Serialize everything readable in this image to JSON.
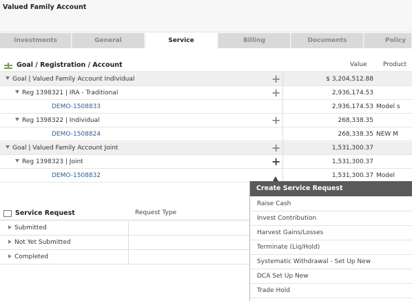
{
  "window": {
    "title": "Valued Family Account"
  },
  "tabs": [
    {
      "label": "Investments"
    },
    {
      "label": "General"
    },
    {
      "label": "Service"
    },
    {
      "label": "Billing"
    },
    {
      "label": "Documents"
    },
    {
      "label": "Policy"
    }
  ],
  "active_tab": "Service",
  "goal_table": {
    "title": "Goal / Registration / Account",
    "col_value": "Value",
    "col_product": "Product",
    "rows": [
      {
        "label": "Goal | Valued Family Account Individual",
        "value": "$ 3,204,512.88",
        "product": ""
      },
      {
        "label": "Reg 1398321 | IRA - Traditional",
        "value": "2,936,174.53",
        "product": ""
      },
      {
        "label": "DEMO-1508833",
        "value": "2,936,174.53",
        "product": "Model s"
      },
      {
        "label": "Reg 1398322 | Individual",
        "value": "268,338.35",
        "product": ""
      },
      {
        "label": "DEMO-1508824",
        "value": "268,338.35",
        "product": "NEW M"
      },
      {
        "label": "Goal | Valued Family Account Joint",
        "value": "1,531,300.37",
        "product": ""
      },
      {
        "label": "Reg 1398323 | Joint",
        "value": "1,531,300.37",
        "product": ""
      },
      {
        "label": "DEMO-1508832",
        "value": "1,531,300.37",
        "product": "Model"
      }
    ]
  },
  "service_request": {
    "title": "Service Request",
    "col_request_type": "Request Type",
    "groups": [
      {
        "label": "Submitted"
      },
      {
        "label": "Not Yet Submitted"
      },
      {
        "label": "Completed"
      }
    ]
  },
  "popup": {
    "title": "Create Service Request",
    "items": [
      {
        "label": "Raise Cash"
      },
      {
        "label": "Invest Contribution"
      },
      {
        "label": "Harvest Gains/Losses"
      },
      {
        "label": "Terminate (Liq/Hold)"
      },
      {
        "label": "Systematic Withdrawal - Set Up New"
      },
      {
        "label": "DCA Set Up New"
      },
      {
        "label": "Trade Hold"
      }
    ]
  }
}
